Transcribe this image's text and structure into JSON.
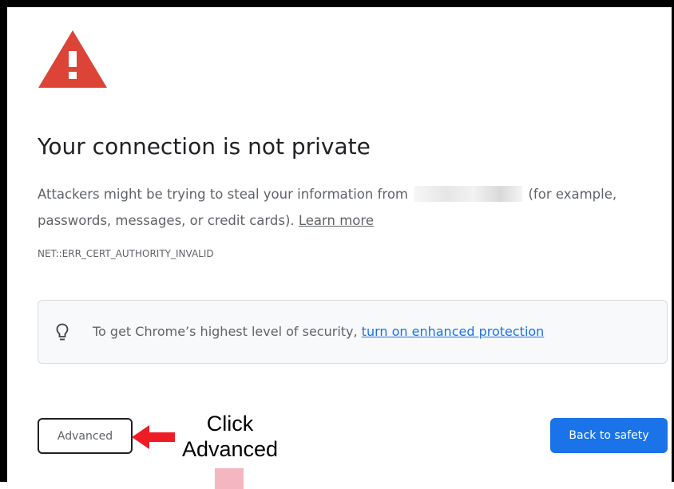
{
  "page": {
    "title": "Your connection is not private",
    "body_before": "Attackers might be trying to steal your information from ",
    "body_after": " (for example, passwords, messages, or credit cards). ",
    "learn_more": "Learn more",
    "error_code": "NET::ERR_CERT_AUTHORITY_INVALID"
  },
  "enhanced": {
    "text": "To get Chrome’s highest level of security, ",
    "link": "turn on enhanced protection",
    "icon": "lightbulb-icon"
  },
  "buttons": {
    "advanced": "Advanced",
    "back_to_safety": "Back to safety"
  },
  "annotation": {
    "line1": "Click",
    "line2": "Advanced",
    "arrow_icon": "red-left-arrow-icon"
  },
  "colors": {
    "warning_red": "#db4437",
    "link_blue": "#1a73e8",
    "annotation_red": "#ee1c25",
    "primary_button": "#1a73e8"
  }
}
